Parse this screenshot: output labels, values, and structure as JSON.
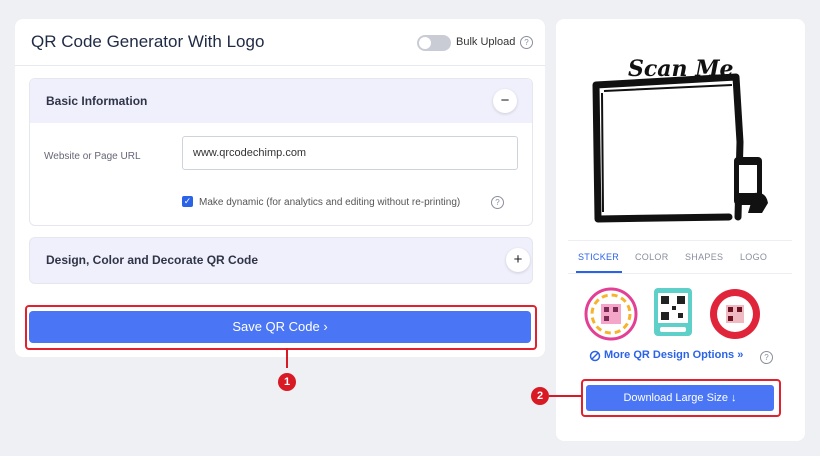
{
  "header": {
    "title": "QR Code Generator With Logo",
    "bulk_upload_label": "Bulk Upload"
  },
  "basic_info": {
    "title": "Basic Information",
    "collapse_symbol": "−",
    "url_label": "Website or Page URL",
    "url_value": "www.qrcodechimp.com",
    "dynamic_label": "Make dynamic (for analytics and editing without re-printing)"
  },
  "design": {
    "title": "Design, Color and Decorate QR Code",
    "expand_symbol": "+"
  },
  "actions": {
    "save_label": "Save QR Code ›",
    "download_label": "Download Large Size ↓"
  },
  "preview": {
    "sticker_text": "Scan Me"
  },
  "tabs": [
    {
      "label": "STICKER",
      "active": true
    },
    {
      "label": "COLOR",
      "active": false
    },
    {
      "label": "SHAPES",
      "active": false
    },
    {
      "label": "LOGO",
      "active": false
    }
  ],
  "more_designs_label": "More QR Design Options »",
  "markers": [
    "1",
    "2"
  ],
  "help_symbol": "?",
  "colors": {
    "accent": "#4a76f5",
    "highlight": "#e1212d",
    "section_bg": "#f0f0fd"
  }
}
